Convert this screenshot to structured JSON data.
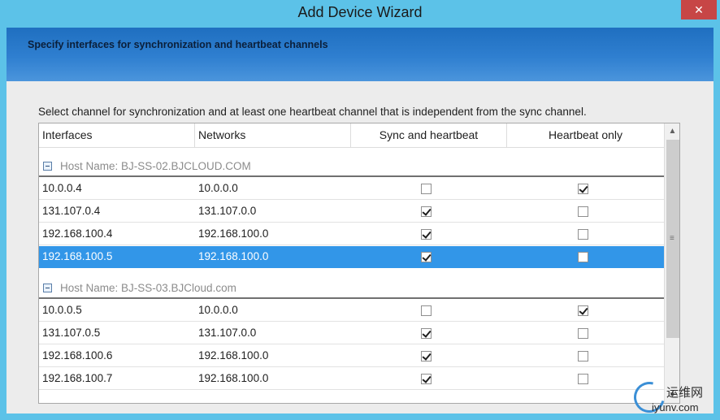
{
  "window": {
    "title": "Add Device Wizard",
    "close_label": "✕"
  },
  "banner": {
    "heading": "Specify interfaces for synchronization and heartbeat channels"
  },
  "instruction": "Select channel for synchronization and at least one heartbeat channel that is independent from the sync channel.",
  "grid": {
    "columns": [
      "Interfaces",
      "Networks",
      "Sync and heartbeat",
      "Heartbeat only"
    ],
    "groups": [
      {
        "label": "Host Name: BJ-SS-02.BJCLOUD.COM",
        "rows": [
          {
            "interface": "10.0.0.4",
            "network": "10.0.0.0",
            "sync": false,
            "heartbeat": true,
            "selected": false
          },
          {
            "interface": "131.107.0.4",
            "network": "131.107.0.0",
            "sync": true,
            "heartbeat": false,
            "selected": false
          },
          {
            "interface": "192.168.100.4",
            "network": "192.168.100.0",
            "sync": true,
            "heartbeat": false,
            "selected": false
          },
          {
            "interface": "192.168.100.5",
            "network": "192.168.100.0",
            "sync": true,
            "heartbeat": false,
            "selected": true
          }
        ]
      },
      {
        "label": "Host Name: BJ-SS-03.BJCloud.com",
        "rows": [
          {
            "interface": "10.0.0.5",
            "network": "10.0.0.0",
            "sync": false,
            "heartbeat": true,
            "selected": false
          },
          {
            "interface": "131.107.0.5",
            "network": "131.107.0.0",
            "sync": true,
            "heartbeat": false,
            "selected": false
          },
          {
            "interface": "192.168.100.6",
            "network": "192.168.100.0",
            "sync": true,
            "heartbeat": false,
            "selected": false
          },
          {
            "interface": "192.168.100.7",
            "network": "192.168.100.0",
            "sync": true,
            "heartbeat": false,
            "selected": false
          }
        ]
      }
    ],
    "scrollbar": {
      "up": "▲",
      "down": "▼",
      "grip": "≡"
    }
  },
  "watermark": {
    "chinese": "运维网",
    "url": "iyunv.com"
  },
  "colors": {
    "title_bar": "#5cc2e8",
    "close_button": "#c74646",
    "banner": "#2f7fd0",
    "selection": "#3296e8"
  }
}
